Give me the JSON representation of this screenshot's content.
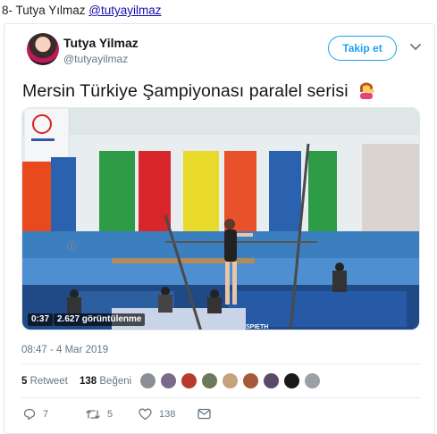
{
  "caption": {
    "prefix": "8- Tutya Yılmaz ",
    "link": "@tutyayilmaz"
  },
  "tweet": {
    "author_name": "Tutya Yilmaz",
    "author_handle": "@tutyayilmaz",
    "follow_label": "Takip et",
    "text": "Mersin Türkiye Şampiyonası paralel serisi",
    "emoji": "woman-tipping-hand-emoji",
    "video": {
      "duration": "0:37",
      "views": "2.627 görüntülenme"
    },
    "timestamp": "08:47 - 4 Mar 2019",
    "retweet_count": "5",
    "retweet_label": "Retweet",
    "like_count": "138",
    "like_label": "Beğeni",
    "actions": {
      "reply_count": "7",
      "retweet_count": "5",
      "like_count": "138"
    }
  },
  "colors": {
    "accent": "#1da1f2",
    "muted": "#657786",
    "text": "#14171a"
  },
  "icons": [
    "chevron-down-icon",
    "reply-icon",
    "retweet-icon",
    "heart-icon",
    "direct-message-icon"
  ]
}
